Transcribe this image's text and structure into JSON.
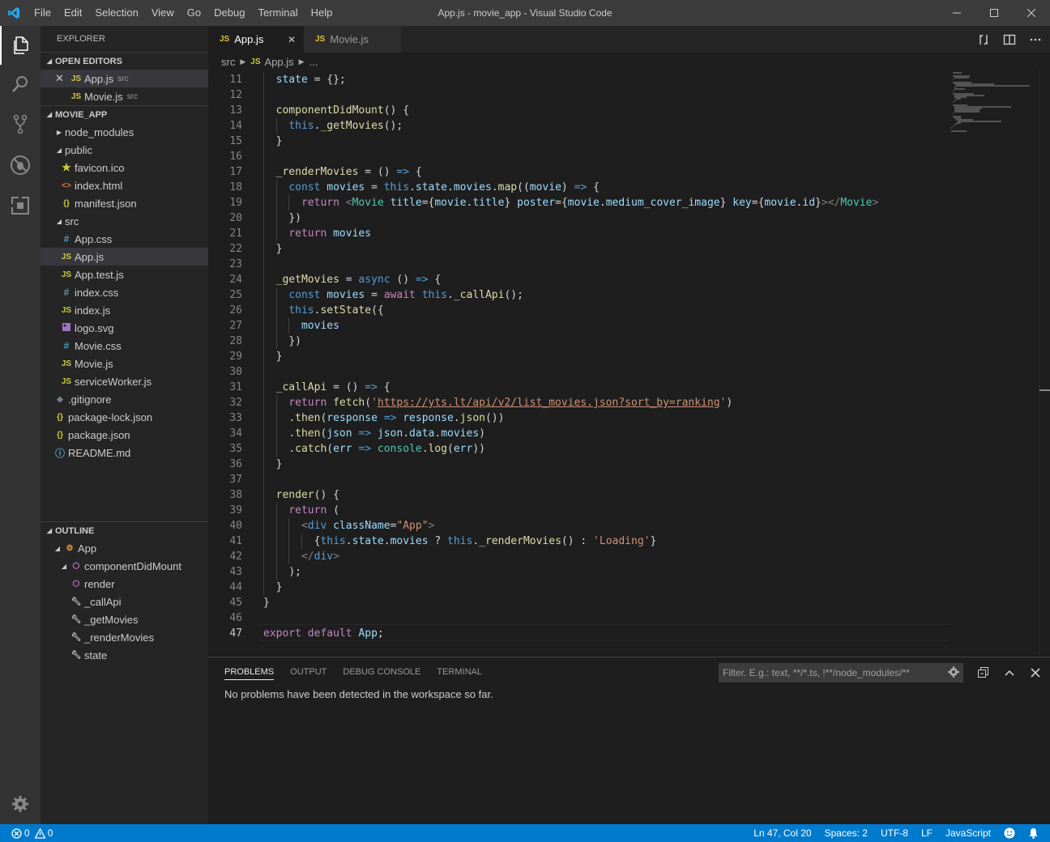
{
  "window": {
    "title": "App.js - movie_app - Visual Studio Code"
  },
  "menu": [
    "File",
    "Edit",
    "Selection",
    "View",
    "Go",
    "Debug",
    "Terminal",
    "Help"
  ],
  "sidebar": {
    "title": "EXPLORER",
    "open_editors": {
      "label": "OPEN EDITORS",
      "items": [
        {
          "name": "App.js",
          "dir": "src"
        },
        {
          "name": "Movie.js",
          "dir": "src"
        }
      ]
    },
    "project": {
      "label": "MOVIE_APP",
      "items": [
        {
          "name": "node_modules"
        },
        {
          "name": "public"
        },
        {
          "name": "favicon.ico"
        },
        {
          "name": "index.html"
        },
        {
          "name": "manifest.json"
        },
        {
          "name": "src"
        },
        {
          "name": "App.css"
        },
        {
          "name": "App.js"
        },
        {
          "name": "App.test.js"
        },
        {
          "name": "index.css"
        },
        {
          "name": "index.js"
        },
        {
          "name": "logo.svg"
        },
        {
          "name": "Movie.css"
        },
        {
          "name": "Movie.js"
        },
        {
          "name": "serviceWorker.js"
        },
        {
          "name": ".gitignore"
        },
        {
          "name": "package-lock.json"
        },
        {
          "name": "package.json"
        },
        {
          "name": "README.md"
        }
      ]
    },
    "outline": {
      "label": "OUTLINE",
      "items": [
        "App",
        "componentDidMount",
        "render",
        "_callApi",
        "_getMovies",
        "_renderMovies",
        "state"
      ]
    }
  },
  "tabs": [
    {
      "label": "App.js",
      "icon": "JS"
    },
    {
      "label": "Movie.js",
      "icon": "JS"
    }
  ],
  "breadcrumb": {
    "folder": "src",
    "file": "App.js",
    "more": "..."
  },
  "editor": {
    "language_icon": "JS",
    "current_line": 47,
    "lines": [
      {
        "n": 11,
        "text": "  state = {};"
      },
      {
        "n": 12,
        "text": ""
      },
      {
        "n": 13,
        "text": "  componentDidMount() {"
      },
      {
        "n": 14,
        "text": "    this._getMovies();"
      },
      {
        "n": 15,
        "text": "  }"
      },
      {
        "n": 16,
        "text": ""
      },
      {
        "n": 17,
        "text": "  _renderMovies = () => {"
      },
      {
        "n": 18,
        "text": "    const movies = this.state.movies.map((movie) => {"
      },
      {
        "n": 19,
        "text": "      return <Movie title={movie.title} poster={movie.medium_cover_image} key={movie.id}></Movie>"
      },
      {
        "n": 20,
        "text": "    })"
      },
      {
        "n": 21,
        "text": "    return movies"
      },
      {
        "n": 22,
        "text": "  }"
      },
      {
        "n": 23,
        "text": ""
      },
      {
        "n": 24,
        "text": "  _getMovies = async () => {"
      },
      {
        "n": 25,
        "text": "    const movies = await this._callApi();"
      },
      {
        "n": 26,
        "text": "    this.setState({"
      },
      {
        "n": 27,
        "text": "      movies"
      },
      {
        "n": 28,
        "text": "    })"
      },
      {
        "n": 29,
        "text": "  }"
      },
      {
        "n": 30,
        "text": ""
      },
      {
        "n": 31,
        "text": "  _callApi = () => {"
      },
      {
        "n": 32,
        "text": "    return fetch('https://yts.lt/api/v2/list_movies.json?sort_by=ranking')"
      },
      {
        "n": 33,
        "text": "    .then(response => response.json())"
      },
      {
        "n": 34,
        "text": "    .then(json => json.data.movies)"
      },
      {
        "n": 35,
        "text": "    .catch(err => console.log(err))"
      },
      {
        "n": 36,
        "text": "  }"
      },
      {
        "n": 37,
        "text": ""
      },
      {
        "n": 38,
        "text": "  render() {"
      },
      {
        "n": 39,
        "text": "    return ("
      },
      {
        "n": 40,
        "text": "      <div className=\"App\">"
      },
      {
        "n": 41,
        "text": "        {this.state.movies ? this._renderMovies() : 'Loading'}"
      },
      {
        "n": 42,
        "text": "      </div>"
      },
      {
        "n": 43,
        "text": "    );"
      },
      {
        "n": 44,
        "text": "  }"
      },
      {
        "n": 45,
        "text": "}"
      },
      {
        "n": 46,
        "text": ""
      },
      {
        "n": 47,
        "text": "export default App;"
      }
    ]
  },
  "panel": {
    "tabs": [
      "PROBLEMS",
      "OUTPUT",
      "DEBUG CONSOLE",
      "TERMINAL"
    ],
    "filter_placeholder": "Filter. E.g.: text, **/*.ts, !**/node_modules/**",
    "message": "No problems have been detected in the workspace so far."
  },
  "status": {
    "errors": "0",
    "warnings": "0",
    "position": "Ln 47, Col 20",
    "spaces": "Spaces: 2",
    "encoding": "UTF-8",
    "eol": "LF",
    "language": "JavaScript"
  },
  "colors": {
    "accent": "#007acc",
    "js_icon": "#cbcb41",
    "json_icon": "#cbcb41",
    "css_icon": "#519aba"
  }
}
